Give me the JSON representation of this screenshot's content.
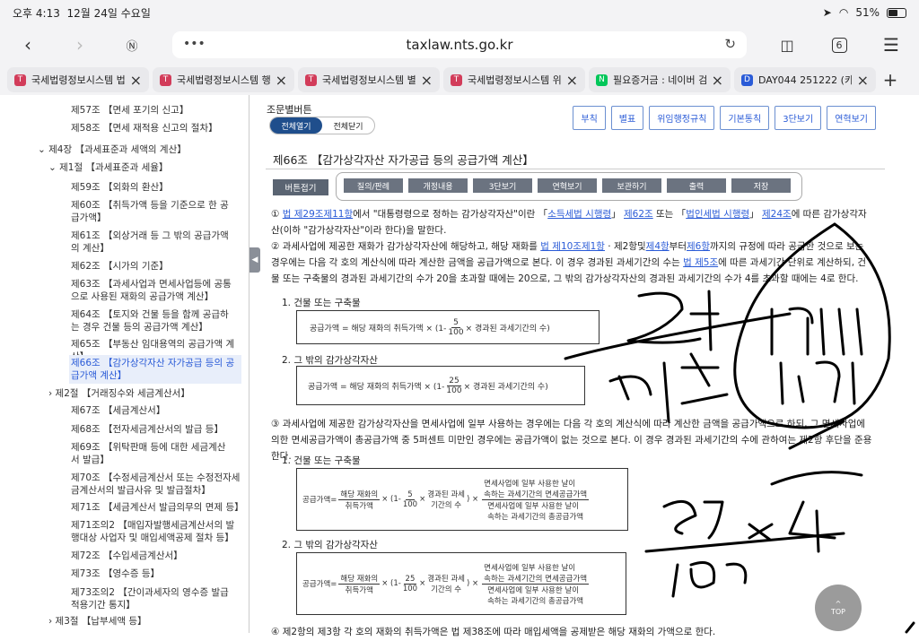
{
  "status": {
    "time": "오후 4:13",
    "date": "12월 24일 수요일",
    "battery": "51%"
  },
  "browser": {
    "url": "taxlaw.nts.go.kr",
    "tab_count": "6"
  },
  "tabs": [
    {
      "title": "국세법령정보시스템 법",
      "fav": "T",
      "color": "#d23c5a"
    },
    {
      "title": "국세법령정보시스템 행",
      "fav": "T",
      "color": "#d23c5a"
    },
    {
      "title": "국세법령정보시스템 별",
      "fav": "T",
      "color": "#d23c5a"
    },
    {
      "title": "국세법령정보시스템 위",
      "fav": "T",
      "color": "#d23c5a"
    },
    {
      "title": "필요증거금 : 네이버 검",
      "fav": "N",
      "color": "#03c75a"
    },
    {
      "title": "DAY044 251222 (카",
      "fav": "D",
      "color": "#2a5bd7"
    }
  ],
  "sidebar": {
    "items": [
      {
        "text": "제57조 【면세 포기의 신고】"
      },
      {
        "text": "제58조 【면세 재적용 신고의 절차】"
      },
      {
        "text": "제4장 【과세표준과 세액의 계산】"
      },
      {
        "text": "제1절 【과세표준과 세율】"
      },
      {
        "text": "제59조 【외화의 환산】"
      },
      {
        "text": "제60조 【취득가액 등을 기준으로 한 공급가액】"
      },
      {
        "text": "제61조 【외상거래 등 그 밖의 공급가액의 계산】"
      },
      {
        "text": "제62조 【시가의 기준】"
      },
      {
        "text": "제63조 【과세사업과 면세사업등에 공통으로 사용된 재화의 공급가액 계산】"
      },
      {
        "text": "제64조 【토지와 건물 등을 함께 공급하는 경우 건물 등의 공급가액 계산】"
      },
      {
        "text": "제65조 【부동산 임대용역의 공급가액 계산】"
      },
      {
        "text": "제66조 【감가상각자산 자가공급 등의 공급가액 계산】"
      },
      {
        "text": "제2절 【거래징수와 세금계산서】"
      },
      {
        "text": "제67조 【세금계산서】"
      },
      {
        "text": "제68조 【전자세금계산서의 발급 등】"
      },
      {
        "text": "제69조 【위탁판매 등에 대한 세금계산서 발급】"
      },
      {
        "text": "제70조 【수정세금계산서 또는 수정전자세금계산서의 발급사유 및 발급절차】"
      },
      {
        "text": "제71조 【세금계산서 발급의무의 면제 등】"
      },
      {
        "text": "제71조의2 【매입자발행세금계산서의 발행대상 사업자 및 매입세액공제 절차 등】"
      },
      {
        "text": "제72조 【수입세금계산서】"
      },
      {
        "text": "제73조 【영수증 등】"
      },
      {
        "text": "제73조의2 【간이과세자의 영수증 발급 적용기간 통지】"
      },
      {
        "text": "제3절 【납부세액 등】"
      }
    ]
  },
  "main": {
    "button_area_title": "조문별버튼",
    "toggle_open": "전체열기",
    "toggle_close": "전체닫기",
    "top_buttons": [
      "부칙",
      "별표",
      "위임행정규칙",
      "기본통칙",
      "3단보기",
      "연혁보기"
    ],
    "article_title": "제66조 【감가상각자산 자가공급 등의 공급가액 계산】",
    "collapse_label": "버튼접기",
    "options": [
      "질의/판례",
      "개정내용",
      "3단보기",
      "연혁보기",
      "보관하기",
      "출력",
      "저장"
    ],
    "p1_a": "① ",
    "p1_link1": "법 제29조제11항",
    "p1_b": "에서 \"대통령령으로 정하는 감가상각자산\"이란 「",
    "p1_link2": "소득세법 시행령",
    "p1_c": "」 ",
    "p1_link3": "제62조",
    "p1_d": " 또는 「",
    "p1_link4": "법인세법 시행령",
    "p1_e": "」 ",
    "p1_link5": "제24조",
    "p1_f": "에 따른 감가상각자산(이하 \"감가상각자산\"이라 한다)을 말한다.",
    "p2_a": "② 과세사업에 제공한 재화가 감가상각자산에 해당하고, 해당 재화를 ",
    "p2_link1": "법 제10조제1항",
    "p2_b": " · 제2항및",
    "p2_link2": "제4항",
    "p2_c": "부터",
    "p2_link3": "제6항",
    "p2_d": "까지의 규정에 따라 공급한 것으로 보는 경우에는 다음 각 호의 계산식에 따라 계산한 금액을 공급가액으로 본다. 이 경우 경과된 과세기간의 수는 ",
    "p2_link4": "법 제5조",
    "p2_e": "에 따른 과세기간 단위로 계산하되, 건물 또는 구축물의 경과된 과세기간의 수가 20을 초과할 때에는 20으로, 그 밖의 감가상각자산의 경과된 과세기간의 수가 4를 초과할 때에는 4로 한다.",
    "s1": "1. 건물 또는 구축물",
    "f1_left": "공급가액 = 해당 재화의 취득가액 × (1-",
    "f1_num": "5",
    "f1_den": "100",
    "f1_right": "× 경과된 과세기간의 수)",
    "s2": "2. 그 밖의 감가상각자산",
    "f2_left": "공급가액 = 해당 재화의 취득가액 × (1-",
    "f2_num": "25",
    "f2_den": "100",
    "f2_right": "× 경과된 과세기간의 수)",
    "p3": "③ 과세사업에 제공한 감가상각자산을 면세사업에 일부 사용하는 경우에는 다음 각 호의 계산식에 따라 계산한 금액을 공급가액으로 하되, 그 면세사업에 의한 면세공급가액이 총공급가액 중 5퍼센트 미만인 경우에는 공급가액이 없는 것으로 본다. 이 경우 경과된 과세기간의 수에 관하여는 제2항 후단을 준용한다.",
    "s3": "1. 건물 또는 구축물",
    "s4": "2. 그 밖의 감가상각자산",
    "f3": {
      "lhs": "공급가액=",
      "a1": "해당 재화의",
      "a2": "취득가액",
      "one": "× (1-",
      "num": "5",
      "den": "100",
      "times": "×",
      "b1": "경과된 과세",
      "b2": "기간의 수",
      "close": ") ×",
      "c1": "면세사업에 일부 사용한 날이",
      "c2": "속하는 과세기간의 면세공급가액",
      "d1": "면세사업에 일부 사용한 날이",
      "d2": "속하는 과세기간의 총공급가액"
    },
    "f4": {
      "lhs": "공급가액=",
      "a1": "해당 재화의",
      "a2": "취득가액",
      "one": "× (1-",
      "num": "25",
      "den": "100",
      "times": "×",
      "b1": "경과된 과세",
      "b2": "기간의 수",
      "close": ") ×",
      "c1": "면세사업에 일부 사용한 날이",
      "c2": "속하는 과세기간의 면세공급가액",
      "d1": "면세사업에 일부 사용한 날이",
      "d2": "속하는 과세기간의 총공급가액"
    },
    "p4_partial": "④ 제2항의 제3항 각 호의 재화의 취득가액은 법 제38조에 따라 매입세액을 공제받은 해당 재화의 가액으로 한다.",
    "top_label": "TOP"
  }
}
